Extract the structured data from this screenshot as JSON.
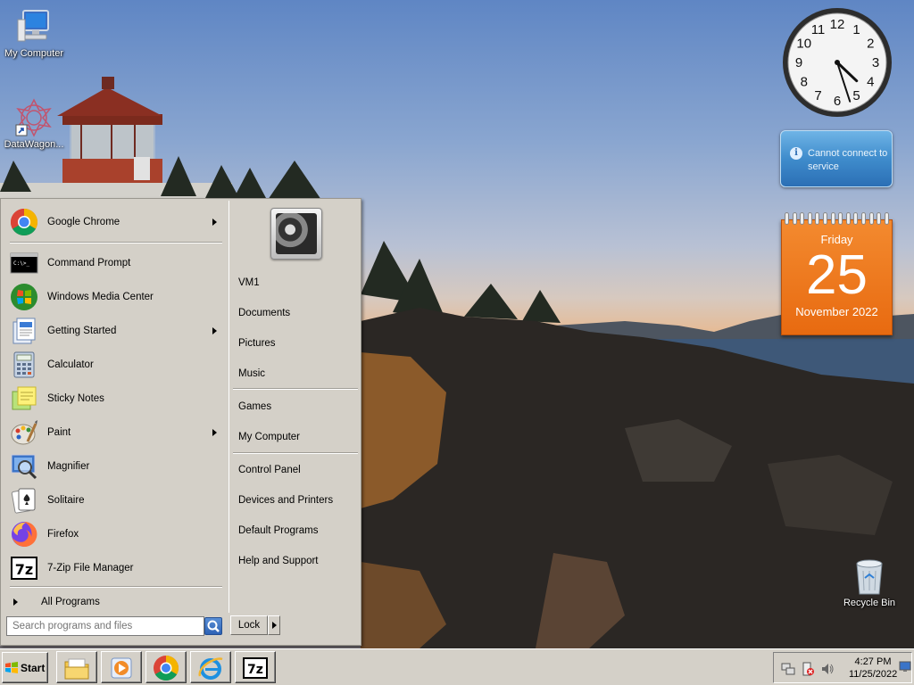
{
  "desktop": {
    "icons": [
      {
        "label": "My Computer",
        "icon": "computer-icon"
      },
      {
        "label": "DataWagon...",
        "icon": "datawagon-shortcut-icon"
      },
      {
        "label": "Recycle Bin",
        "icon": "recycle-bin-icon"
      }
    ]
  },
  "gadgets": {
    "clock": {
      "time": "4:27",
      "numerals": [
        "12",
        "1",
        "2",
        "3",
        "4",
        "5",
        "6",
        "7",
        "8",
        "9",
        "10",
        "11"
      ]
    },
    "weather": {
      "message": "Cannot connect to service",
      "icon": "info-icon"
    },
    "calendar": {
      "weekday": "Friday",
      "day": "25",
      "month_year": "November 2022"
    }
  },
  "start_menu": {
    "pinned": [
      {
        "label": "Google Chrome",
        "icon": "chrome-icon",
        "submenu": true
      }
    ],
    "recent": [
      {
        "label": "Command Prompt",
        "icon": "command-prompt-icon",
        "submenu": false
      },
      {
        "label": "Windows Media Center",
        "icon": "media-center-icon",
        "submenu": false
      },
      {
        "label": "Getting Started",
        "icon": "getting-started-icon",
        "submenu": true
      },
      {
        "label": "Calculator",
        "icon": "calculator-icon",
        "submenu": false
      },
      {
        "label": "Sticky Notes",
        "icon": "sticky-notes-icon",
        "submenu": false
      },
      {
        "label": "Paint",
        "icon": "paint-icon",
        "submenu": true
      },
      {
        "label": "Magnifier",
        "icon": "magnifier-icon",
        "submenu": false
      },
      {
        "label": "Solitaire",
        "icon": "solitaire-icon",
        "submenu": false
      },
      {
        "label": "Firefox",
        "icon": "firefox-icon",
        "submenu": false
      },
      {
        "label": "7-Zip File Manager",
        "icon": "7zip-icon",
        "submenu": false
      }
    ],
    "all_programs": "All Programs",
    "search_placeholder": "Search programs and files",
    "right_items": [
      "VM1",
      "Documents",
      "Pictures",
      "Music",
      "Games",
      "My Computer",
      "Control Panel",
      "Devices and Printers",
      "Default Programs",
      "Help and Support"
    ],
    "lock_label": "Lock"
  },
  "taskbar": {
    "start_label": "Start",
    "pinned": [
      {
        "icon": "file-explorer-icon"
      },
      {
        "icon": "media-player-icon"
      },
      {
        "icon": "chrome-icon"
      },
      {
        "icon": "internet-explorer-icon"
      },
      {
        "icon": "7zip-icon"
      }
    ],
    "tray": {
      "time": "4:27 PM",
      "date": "11/25/2022"
    }
  }
}
